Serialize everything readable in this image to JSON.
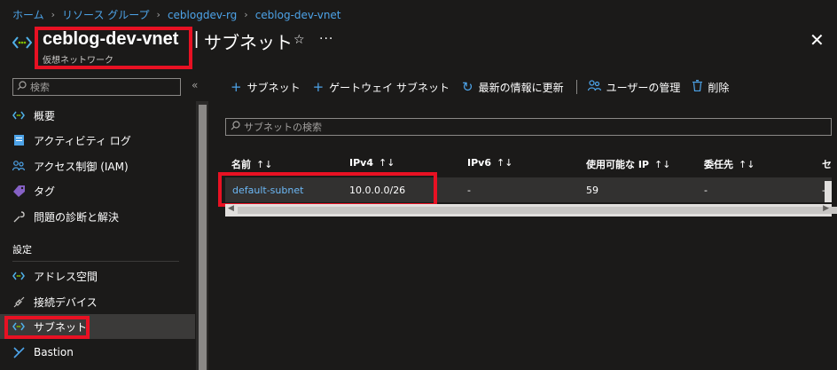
{
  "breadcrumb": [
    "ホーム",
    "リソース グループ",
    "ceblogdev-rg",
    "ceblog-dev-vnet"
  ],
  "header": {
    "resource_name": "ceblog-dev-vnet",
    "resource_type": "仮想ネットワーク",
    "pipe": "|",
    "page_name": "サブネット",
    "star": "☆",
    "more": "···",
    "close": "✕"
  },
  "sidebar": {
    "search_placeholder": "検索",
    "collapse": "«",
    "items": [
      {
        "label": "概要",
        "icon": "vnet-icon"
      },
      {
        "label": "アクティビティ ログ",
        "icon": "activity-log-icon"
      },
      {
        "label": "アクセス制御 (IAM)",
        "icon": "iam-icon"
      },
      {
        "label": "タグ",
        "icon": "tag-icon"
      },
      {
        "label": "問題の診断と解決",
        "icon": "wrench-icon"
      }
    ],
    "section_label": "設定",
    "settings_items": [
      {
        "label": "アドレス空間",
        "icon": "vnet-icon"
      },
      {
        "label": "接続デバイス",
        "icon": "plug-icon"
      },
      {
        "label": "サブネット",
        "icon": "vnet-icon",
        "active": true
      },
      {
        "label": "Bastion",
        "icon": "bastion-icon"
      }
    ]
  },
  "toolbar": {
    "add_subnet": "サブネット",
    "add_gateway_subnet": "ゲートウェイ サブネット",
    "refresh": "最新の情報に更新",
    "manage_users": "ユーザーの管理",
    "delete": "削除"
  },
  "filter": {
    "placeholder": "サブネットの検索"
  },
  "table": {
    "columns": [
      "名前",
      "IPv4",
      "IPv6",
      "使用可能な IP",
      "委任先",
      "セ"
    ],
    "sort_glyph": "↑↓",
    "rows": [
      {
        "name": "default-subnet",
        "ipv4": "10.0.0.0/26",
        "ipv6": "-",
        "available_ip": "59",
        "delegation": "-",
        "extra": "-"
      }
    ]
  },
  "colors": {
    "background": "#1b1a19",
    "link": "#4da3e8",
    "highlight": "#e81123",
    "active_nav": "#3b3a39"
  }
}
